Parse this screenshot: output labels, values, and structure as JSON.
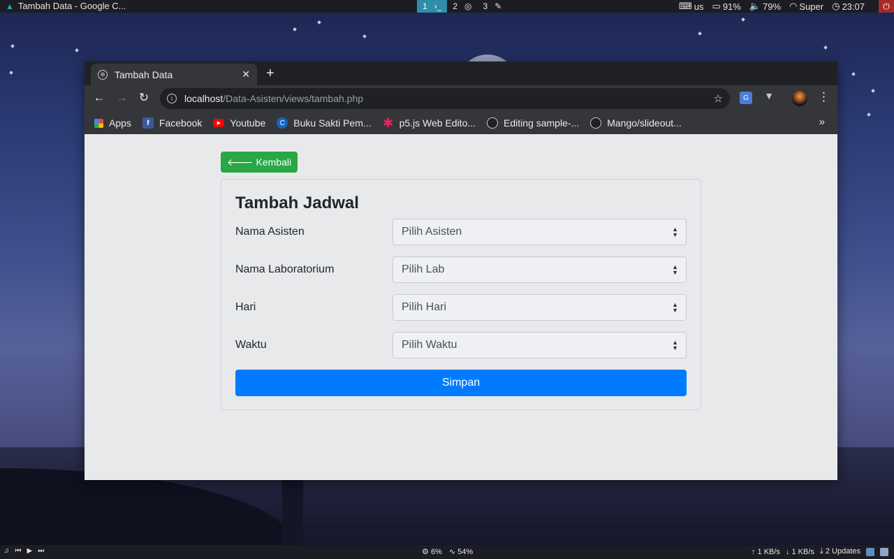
{
  "top_panel": {
    "window_title": "Tambah Data - Google C...",
    "workspaces": [
      "1",
      "2",
      "3"
    ],
    "keyboard": "us",
    "battery": "91%",
    "volume": "79%",
    "wifi": "Super",
    "clock": "23:07"
  },
  "browser": {
    "tab_title": "Tambah Data",
    "url_host": "localhost",
    "url_path": "/Data-Asisten/views/tambah.php",
    "bookmarks": [
      "Apps",
      "Facebook",
      "Youtube",
      "Buku Sakti Pem...",
      "p5.js Web Edito...",
      "Editing sample-...",
      "Mango/slideout..."
    ]
  },
  "page": {
    "back_label": "Kembali",
    "title": "Tambah Jadwal",
    "fields": [
      {
        "label": "Nama Asisten",
        "placeholder": "Pilih Asisten"
      },
      {
        "label": "Nama Laboratorium",
        "placeholder": "Pilih Lab"
      },
      {
        "label": "Hari",
        "placeholder": "Pilih Hari"
      },
      {
        "label": "Waktu",
        "placeholder": "Pilih Waktu"
      }
    ],
    "submit_label": "Simpan"
  },
  "bottom_panel": {
    "cpu": "6%",
    "mem": "54%",
    "upload": "1 KB/s",
    "download": "1 KB/s",
    "updates": "2 Updates"
  },
  "colors": {
    "back_button": "#28a745",
    "submit_button": "#007bff",
    "active_workspace": "#2e8ea8",
    "power_button": "#a52a2a"
  }
}
